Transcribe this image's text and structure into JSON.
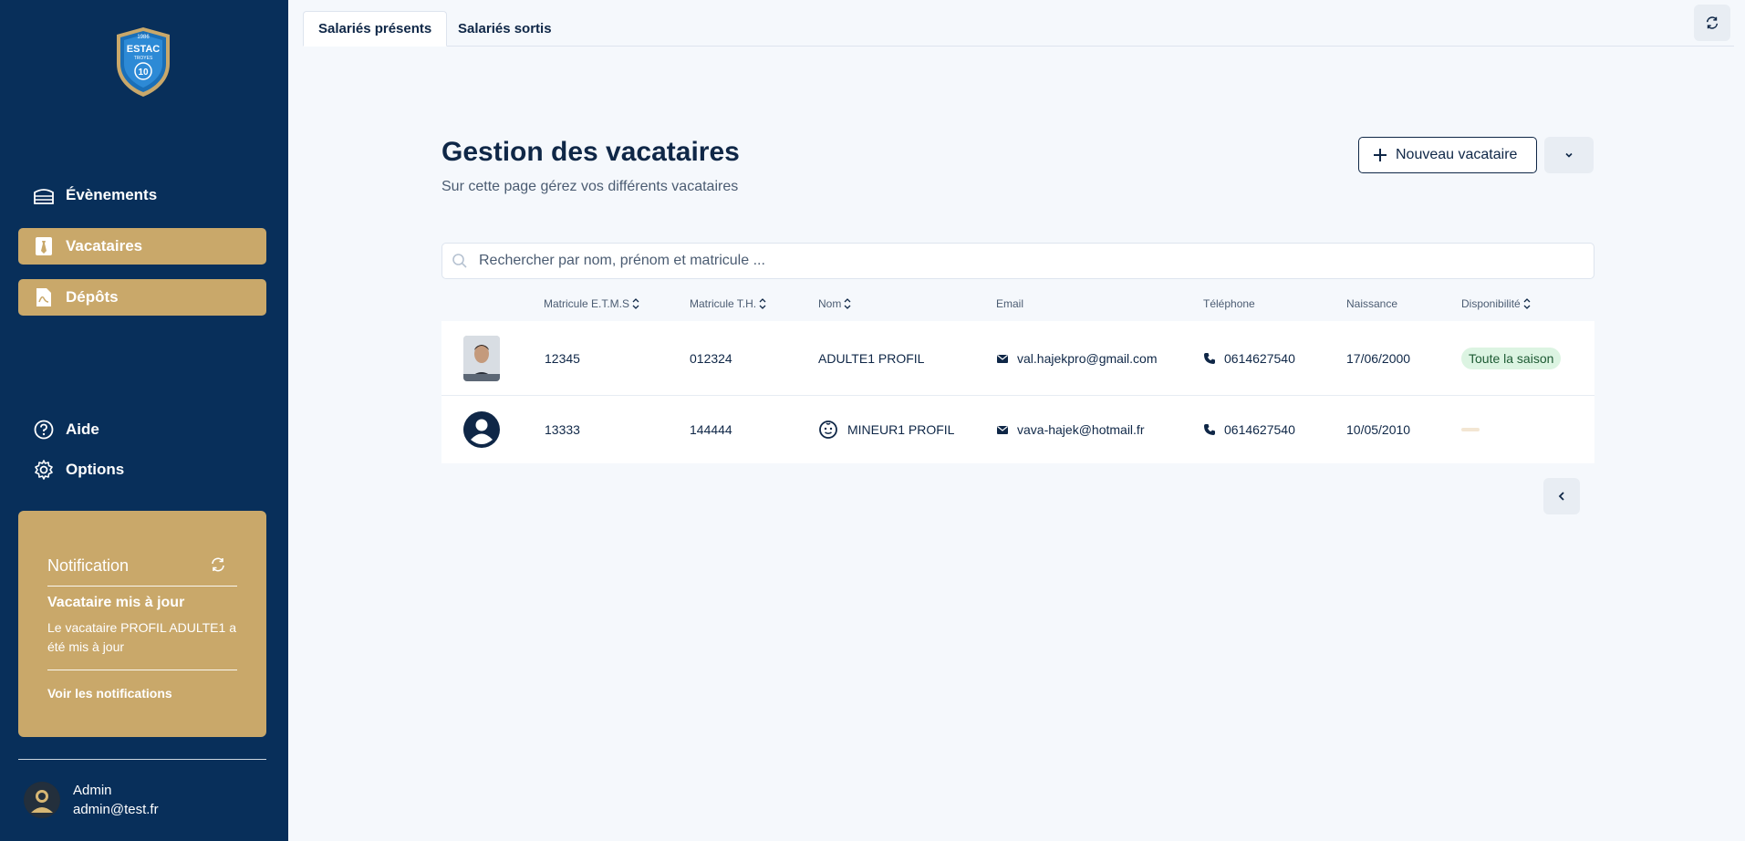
{
  "sidebar": {
    "logo": {
      "year": "1986",
      "name": "ESTAC",
      "sub": "TROYES",
      "number": "10"
    },
    "nav": [
      {
        "label": "Évènements",
        "icon": "stadium-icon"
      },
      {
        "label": "Vacataires",
        "icon": "tie-icon"
      },
      {
        "label": "Dépôts",
        "icon": "document-icon"
      }
    ],
    "bottom_nav": [
      {
        "label": "Aide",
        "icon": "help-circle-icon"
      },
      {
        "label": "Options",
        "icon": "gear-icon"
      }
    ],
    "notification": {
      "title": "Notification",
      "heading": "Vacataire mis à jour",
      "body": "Le vacataire PROFIL ADULTE1 a été mis à jour",
      "link": "Voir les notifications"
    },
    "user": {
      "name": "Admin",
      "email": "admin@test.fr"
    }
  },
  "tabs": [
    {
      "label": "Salariés présents",
      "active": true
    },
    {
      "label": "Salariés sortis",
      "active": false
    }
  ],
  "main": {
    "title": "Gestion des vacataires",
    "subtitle": "Sur cette page gérez vos différents vacataires",
    "new_button": "Nouveau vacataire",
    "search_placeholder": "Rechercher par nom, prénom et matricule ...",
    "columns": [
      "Matricule E.T.M.S",
      "Matricule T.H.",
      "Nom",
      "Email",
      "Téléphone",
      "Naissance",
      "Disponibilité"
    ],
    "rows": [
      {
        "matricule_etms": "12345",
        "matricule_th": "012324",
        "nom": "ADULTE1 PROFIL",
        "email": "val.hajekpro@gmail.com",
        "telephone": "0614627540",
        "naissance": "17/06/2000",
        "disponibilite": "Toute la saison",
        "minor": false
      },
      {
        "matricule_etms": "13333",
        "matricule_th": "144444",
        "nom": "MINEUR1 PROFIL",
        "email": "vava-hajek@hotmail.fr",
        "telephone": "0614627540",
        "naissance": "10/05/2010",
        "disponibilite": "",
        "minor": true
      }
    ]
  },
  "colors": {
    "sidebar": "#082f5a",
    "accent": "#c9a86a",
    "background": "#f5f8fc",
    "text": "#0f2747",
    "badge": "#dcf4e2"
  }
}
